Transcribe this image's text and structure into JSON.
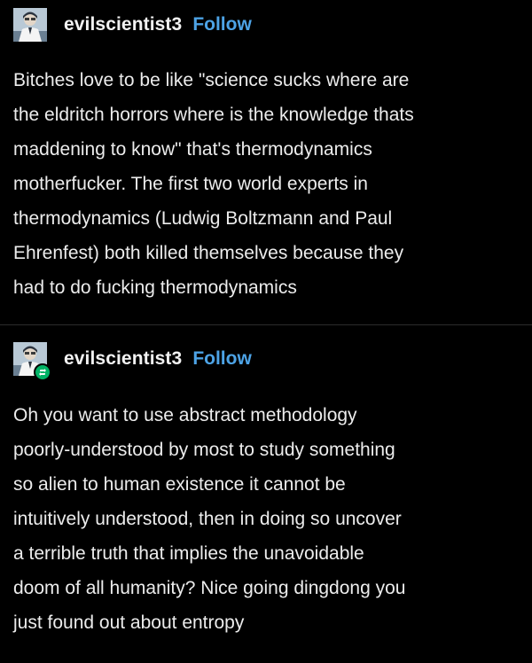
{
  "posts": [
    {
      "username": "evilscientist3",
      "follow_label": "Follow",
      "avatar_icon": "scientist-avatar-icon",
      "reblogged": false,
      "lines": [
        "Bitches love to be like \"science sucks where are",
        "the eldritch horrors where is the knowledge thats",
        "maddening to know\" that's thermodynamics",
        "motherfucker. The first two world experts in",
        "thermodynamics (Ludwig Boltzmann and Paul",
        "Ehrenfest) both killed themselves because they",
        "had to do fucking thermodynamics"
      ]
    },
    {
      "username": "evilscientist3",
      "follow_label": "Follow",
      "avatar_icon": "scientist-avatar-icon",
      "reblogged": true,
      "badge_icon": "reblog-icon",
      "lines": [
        "Oh you want to use abstract methodology",
        "poorly-understood by most to study something",
        "so alien to human existence it cannot be",
        "intuitively understood, then in doing so uncover",
        "a terrible truth that implies the unavoidable",
        "doom of all humanity? Nice going dingdong you",
        "just found out about entropy"
      ]
    }
  ],
  "colors": {
    "background": "#000000",
    "text": "#ececec",
    "follow": "#4da3e6",
    "reblog_badge": "#00b366",
    "divider": "#2c2c2c"
  }
}
